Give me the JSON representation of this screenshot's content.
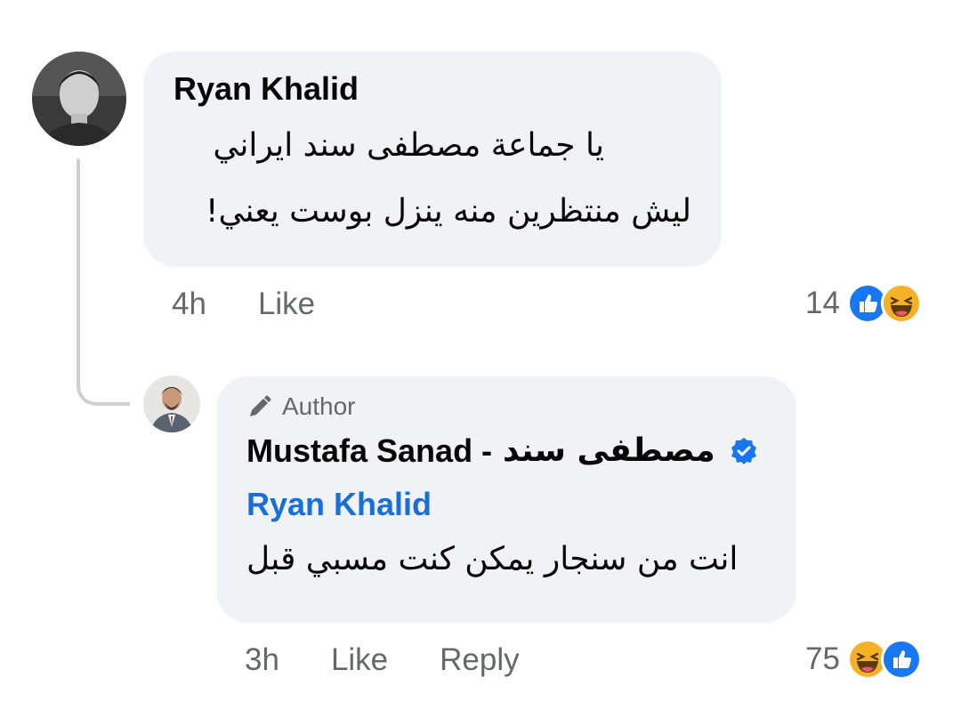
{
  "comments": [
    {
      "author": "Ryan Khalid",
      "text_lines": [
        "يا جماعة مصطفى سند ايراني",
        "ليش منتظرين منه ينزل بوست يعني!"
      ],
      "time": "4h",
      "like_label": "Like",
      "reaction_count": "14",
      "reactions": [
        "like-icon",
        "haha-icon"
      ]
    },
    {
      "badge": "Author",
      "author_latin": "Mustafa Sanad -",
      "author_arabic": "مصطفى سند",
      "verified": true,
      "mention": "Ryan Khalid",
      "text": "انت من سنجار يمكن كنت مسبي قبل",
      "time": "3h",
      "like_label": "Like",
      "reply_label": "Reply",
      "reaction_count": "75",
      "reactions": [
        "haha-icon",
        "like-icon"
      ]
    }
  ],
  "colors": {
    "bubble": "#f0f2f5",
    "meta_gray": "#65676b",
    "mention_blue": "#1a6ed8",
    "like_blue": "#1877f2",
    "haha_yellow": "#f7b125"
  }
}
